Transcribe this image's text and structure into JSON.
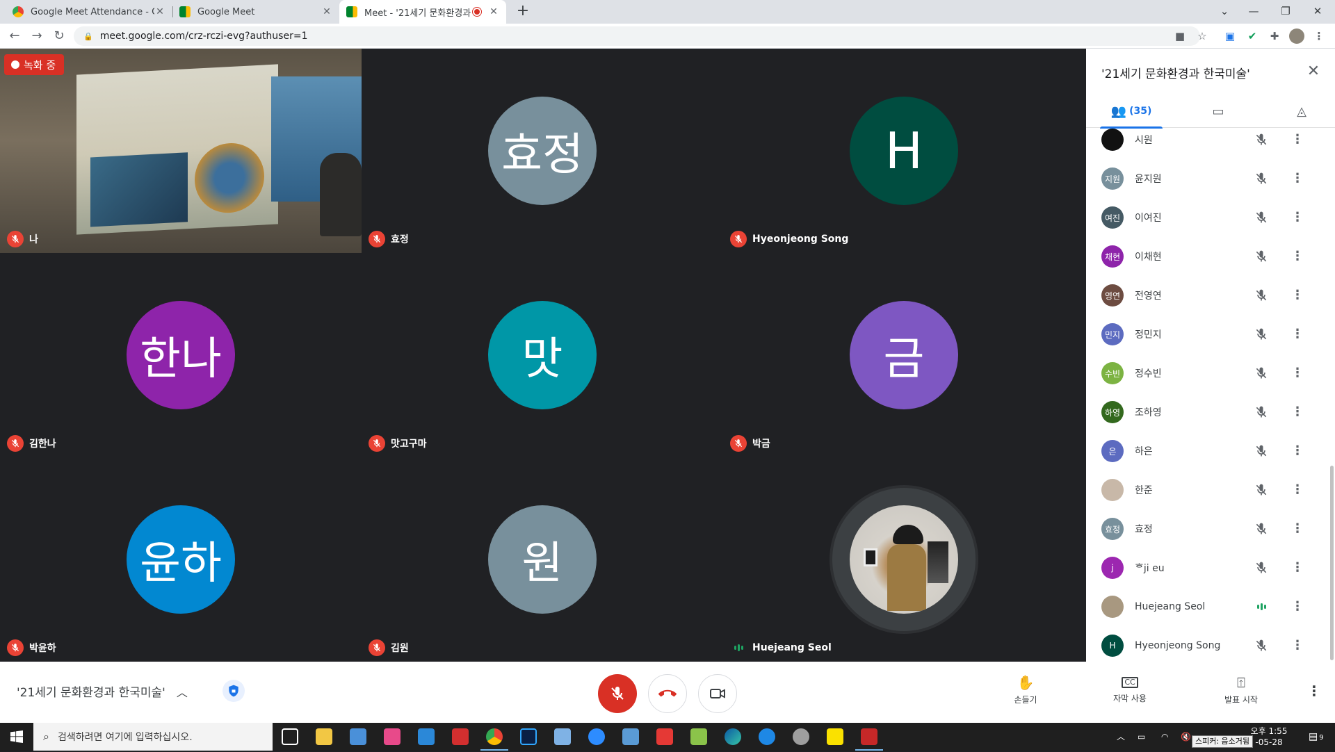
{
  "browser": {
    "tabs": [
      {
        "title": "Google Meet Attendance - Chro",
        "favicon_color": "#e8453c"
      },
      {
        "title": "Google Meet",
        "favicon_color": "#00832d"
      },
      {
        "title": "Meet - '21세기 문화환경과",
        "favicon_color": "#00832d",
        "active": true
      }
    ],
    "url": "meet.google.com/crz-rczi-evg?authuser=1"
  },
  "meeting": {
    "recording_label": "녹화 중",
    "name": "'21세기 문화환경과 한국미술'"
  },
  "tiles": [
    {
      "name": "나",
      "type": "video",
      "muted": true
    },
    {
      "name": "효정",
      "initials": "효정",
      "color": "#78909c",
      "muted": true
    },
    {
      "name": "Hyeonjeong Song",
      "initials": "H",
      "color": "#004d40",
      "muted": true
    },
    {
      "name": "김한나",
      "initials": "한나",
      "color": "#8e24aa",
      "muted": true
    },
    {
      "name": "맛고구마",
      "initials": "맛",
      "color": "#0097a7",
      "muted": true
    },
    {
      "name": "박금",
      "initials": "금",
      "color": "#7e57c2",
      "muted": true
    },
    {
      "name": "박윤하",
      "initials": "윤하",
      "color": "#0288d1",
      "muted": true
    },
    {
      "name": "김원",
      "initials": "원",
      "color": "#78909c",
      "muted": true
    },
    {
      "name": "Huejeang Seol",
      "type": "photo",
      "muted": false
    }
  ],
  "sidebar": {
    "title": "'21세기 문화환경과 한국미술'",
    "people_count": "(35)",
    "participants": [
      {
        "name": "시원",
        "initials": "",
        "color": "#111111",
        "speaking": false
      },
      {
        "name": "윤지원",
        "initials": "지원",
        "color": "#78909c",
        "speaking": false
      },
      {
        "name": "이여진",
        "initials": "여진",
        "color": "#455a64",
        "speaking": false
      },
      {
        "name": "이채현",
        "initials": "채현",
        "color": "#8e24aa",
        "speaking": false
      },
      {
        "name": "전영연",
        "initials": "영연",
        "color": "#6d4c41",
        "speaking": false
      },
      {
        "name": "정민지",
        "initials": "민지",
        "color": "#5c6bc0",
        "speaking": false
      },
      {
        "name": "정수빈",
        "initials": "수빈",
        "color": "#7cb342",
        "speaking": false
      },
      {
        "name": "조하영",
        "initials": "하영",
        "color": "#33691e",
        "speaking": false
      },
      {
        "name": "하은",
        "initials": "은",
        "color": "#5c6bc0",
        "speaking": false
      },
      {
        "name": "한준",
        "initials": "",
        "color": "#c8b8a8",
        "speaking": false
      },
      {
        "name": "효정",
        "initials": "효정",
        "color": "#78909c",
        "speaking": false
      },
      {
        "name": "ᄒji eu",
        "initials": "j",
        "color": "#9c27b0",
        "speaking": false
      },
      {
        "name": "Huejeang Seol",
        "initials": "",
        "color": "#a89880",
        "speaking": true
      },
      {
        "name": "Hyeonjeong Song",
        "initials": "H",
        "color": "#004d40",
        "speaking": false
      }
    ]
  },
  "controls": {
    "raise_hand": "손들기",
    "captions": "자막 사용",
    "present": "발표 시작"
  },
  "taskbar": {
    "search_placeholder": "검색하려면 여기에 입력하십시오.",
    "time": "오후 1:55",
    "date": "-05-28",
    "tooltip": "스피커: 음소거됨",
    "notif_count": "9"
  }
}
